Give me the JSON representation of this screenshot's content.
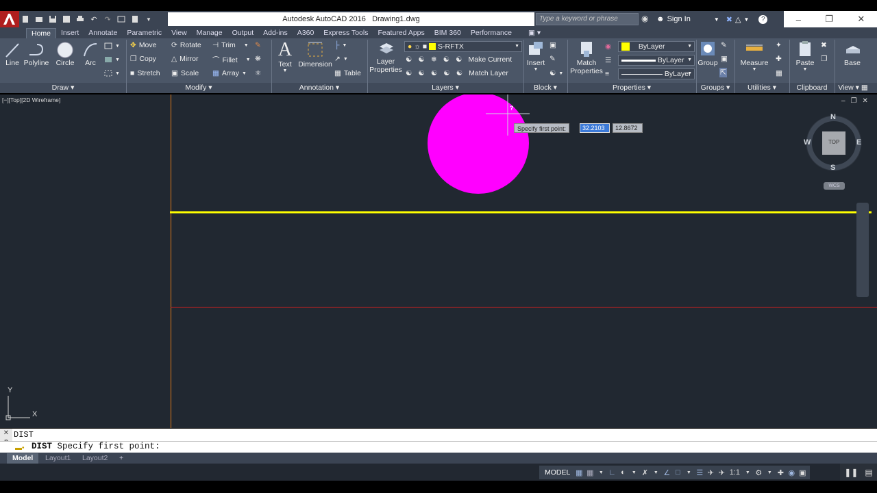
{
  "app": {
    "title_prefix": "Autodesk AutoCAD 2016",
    "title_file": "Drawing1.dwg",
    "search_placeholder": "Type a keyword or phrase",
    "signin": "Sign In"
  },
  "tabs": [
    "Home",
    "Insert",
    "Annotate",
    "Parametric",
    "View",
    "Manage",
    "Output",
    "Add-ins",
    "A360",
    "Express Tools",
    "Featured Apps",
    "BIM 360",
    "Performance"
  ],
  "ribbon": {
    "draw": {
      "line": "Line",
      "polyline": "Polyline",
      "circle": "Circle",
      "arc": "Arc",
      "panel": "Draw"
    },
    "modify": {
      "move": "Move",
      "rotate": "Rotate",
      "trim": "Trim",
      "copy": "Copy",
      "mirror": "Mirror",
      "fillet": "Fillet",
      "stretch": "Stretch",
      "scale": "Scale",
      "array": "Array",
      "panel": "Modify"
    },
    "annotation": {
      "text": "Text",
      "dimension": "Dimension",
      "table": "Table",
      "panel": "Annotation"
    },
    "layers": {
      "layer_props_1": "Layer",
      "layer_props_2": "Properties",
      "current_layer": "S-RFTX",
      "make_current": "Make Current",
      "match_layer": "Match Layer",
      "panel": "Layers"
    },
    "block": {
      "insert": "Insert",
      "panel": "Block"
    },
    "properties": {
      "match_1": "Match",
      "match_2": "Properties",
      "color": "ByLayer",
      "lineweight": "ByLayer",
      "linetype": "ByLayer",
      "panel": "Properties",
      "layer_color": "#ffff00"
    },
    "groups": {
      "group": "Group",
      "panel": "Groups"
    },
    "utilities": {
      "measure": "Measure",
      "panel": "Utilities"
    },
    "clipboard": {
      "paste": "Paste",
      "panel": "Clipboard"
    },
    "view": {
      "base": "Base",
      "panel": "View"
    }
  },
  "viewport": {
    "label": "[−][Top][2D Wireframe]",
    "tooltip_prompt": "Specify first point:",
    "coord_x": "32.2103",
    "coord_y": "12.8672",
    "cursor_hint": "?",
    "compass": {
      "n": "N",
      "s": "S",
      "e": "E",
      "w": "W",
      "top": "TOP",
      "wcs": "WCS"
    },
    "ucs": {
      "x": "X",
      "y": "Y"
    },
    "circle_color": "#ff00ff",
    "line_color": "#ffff00",
    "limit_color": "#d02020",
    "boundary_color": "#e07a1a"
  },
  "command": {
    "history": "DIST",
    "prompt_cmd": "DIST",
    "prompt_text": "Specify first point:"
  },
  "layouts": [
    "Model",
    "Layout1",
    "Layout2"
  ],
  "status": {
    "model": "MODEL",
    "scale": "1:1"
  }
}
